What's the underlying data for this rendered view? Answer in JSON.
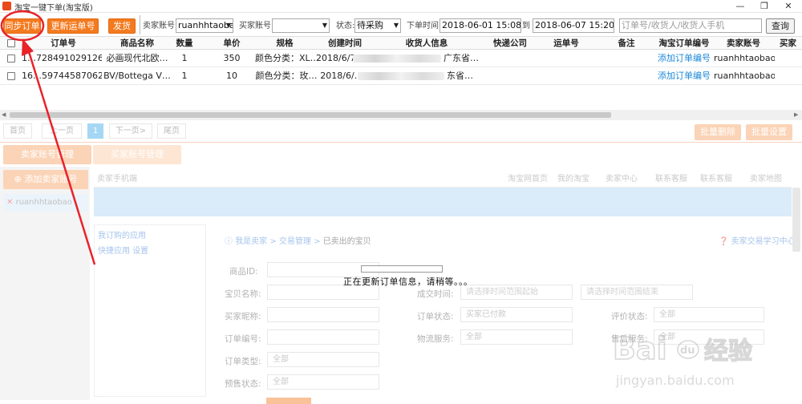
{
  "window": {
    "title": "淘宝一键下单(淘宝版)",
    "min_symbol": "—",
    "max_symbol": "❐",
    "close_symbol": "✕"
  },
  "toolbar": {
    "sync_orders": "同步订单",
    "update_tracking": "更新运单号",
    "ship": "发货",
    "seller_label": "卖家账号:",
    "seller_value": "ruanhhtaoba",
    "buyer_label": "买家账号:",
    "buyer_value": "",
    "status_label": "状态:",
    "status_value": "待采购",
    "time_label": "下单时间:",
    "time_start": "2018-06-01 15:08:49",
    "time_sep": "到",
    "time_end": "2018-06-07 15:20:49",
    "search_placeholder": "订单号/收货人/收货人手机",
    "query": "查询"
  },
  "table": {
    "headers": [
      "订单号",
      "商品名称",
      "数量",
      "单价",
      "规格",
      "创建时间",
      "收货人信息",
      "快递公司",
      "运单号",
      "备注",
      "淘宝订单编号",
      "卖家账号",
      "买家"
    ],
    "rows": [
      {
        "order_id": "1…7284910291268…",
        "product": "必画现代北欧…",
        "qty": "1",
        "price": "350",
        "spec": "颜色分类：XL…",
        "created": "2018/6/7 1…",
        "receiver": "广东省…",
        "courier": "",
        "tracking": "",
        "note": "",
        "taobao_order": "添加订单编号",
        "seller": "ruanhhtaobao"
      },
      {
        "order_id": "16…597445870629…",
        "product": "BV/Bottega V…",
        "qty": "1",
        "price": "10",
        "spec": "颜色分类：玫…",
        "created": "2018/6/…",
        "receiver": "东省…",
        "courier": "",
        "tracking": "",
        "note": "",
        "taobao_order": "添加订单编号",
        "seller": "ruanhhtaobao"
      }
    ]
  },
  "background": {
    "pager": [
      "首页",
      "上一页",
      "1",
      "下一页>",
      "尾页"
    ],
    "batch_delete": "批量删除",
    "batch_settings": "批量设置",
    "tab_seller": "卖家账号管理",
    "tab_buyer": "买家账号管理",
    "add_seller": "添加卖家账号",
    "seller_item": "ruanhhtaobao",
    "mobile_hint": "卖家手机端",
    "nav": [
      "淘宝网首页",
      "我的淘宝",
      "卖家中心",
      "联系客服",
      "联系客服",
      "卖家地图"
    ],
    "apps": [
      "我订购的应用",
      "快捷应用 设置"
    ],
    "breadcrumb": [
      "我是卖家",
      "交易管理",
      "已卖出的宝贝"
    ],
    "learn": "卖家交易学习中心",
    "fields": [
      {
        "label": "商品ID:",
        "placeholder": ""
      },
      {
        "label": "宝贝名称:",
        "placeholder": ""
      },
      {
        "label": "买家昵称:",
        "placeholder": ""
      },
      {
        "label": "订单编号:",
        "placeholder": ""
      },
      {
        "label": "订单类型:",
        "placeholder": "全部"
      },
      {
        "label": "预售状态:",
        "placeholder": "全部"
      }
    ],
    "mid_fields": [
      {
        "label": "成交时间:",
        "placeholder": "请选择时间范围起始"
      },
      {
        "label": "订单状态:",
        "placeholder": "买家已付款"
      },
      {
        "label": "物流服务:",
        "placeholder": "全部"
      }
    ],
    "range_end": "请选择时间范围结束",
    "right_fields": [
      {
        "label": "评价状态:",
        "placeholder": "全部"
      },
      {
        "label": "售后服务:",
        "placeholder": "全部"
      }
    ]
  },
  "loading_text": "正在更新订单信息，请稍等。。。",
  "watermark": {
    "brand": "Bai",
    "paw": "du",
    "cn": "经验",
    "url": "jingyan.baidu.com"
  },
  "colors": {
    "accent_orange": "#f47a1f",
    "link_blue": "#1e88d8",
    "annotation_red": "#e8232a"
  }
}
